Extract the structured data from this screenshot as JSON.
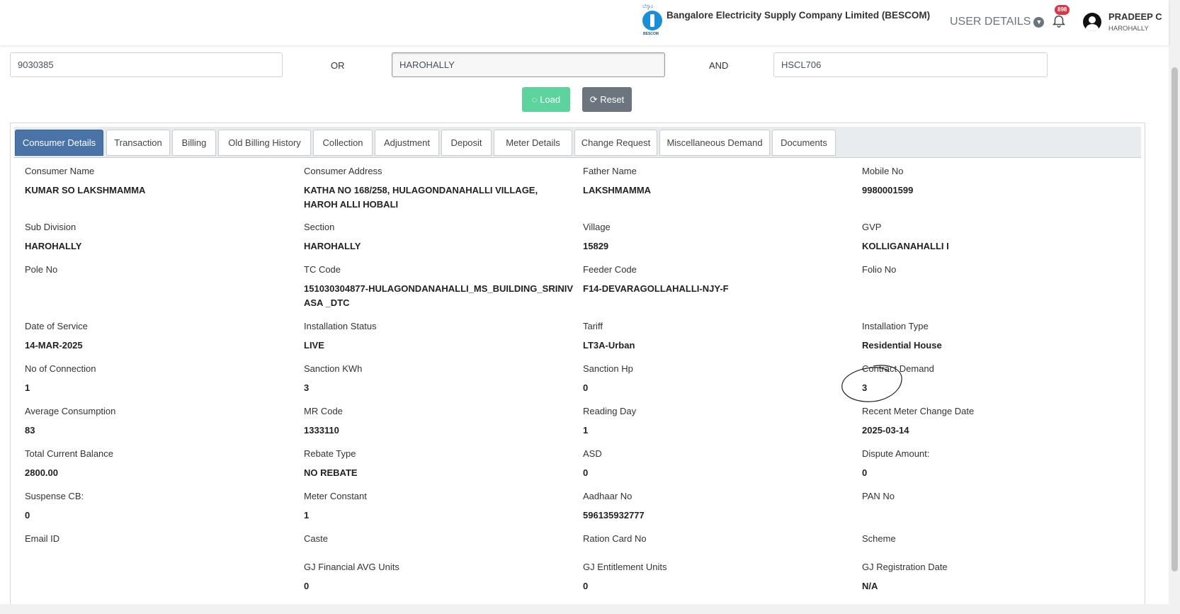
{
  "header": {
    "logo_top": "ಬೆಸ್ಕಾಂ",
    "logo_bottom": "BESCOM",
    "company": "Bangalore Electricity Supply Company Limited (BESCOM)",
    "user_details": "USER DETAILS",
    "notification_count": "898",
    "user_name": "PRADEEP C",
    "user_location": "HAROHALLY"
  },
  "search": {
    "account_value": "9030385",
    "joiner_or": "OR",
    "location_value": "HAROHALLY",
    "joiner_and": "AND",
    "code_value": "HSCL706",
    "load_label": "Load",
    "reset_label": "Reset"
  },
  "tabs": [
    "Consumer Details",
    "Transaction",
    "Billing",
    "Old Billing History",
    "Collection",
    "Adjustment",
    "Deposit",
    "Meter Details",
    "Change Request",
    "Miscellaneous Demand",
    "Documents"
  ],
  "fields": [
    {
      "label": "Consumer Name",
      "value": "KUMAR SO LAKSHMAMMA"
    },
    {
      "label": "Consumer Address",
      "value": "KATHA NO 168/258, HULAGONDANAHALLI VILLAGE, HAROH ALLI HOBALI"
    },
    {
      "label": "Father Name",
      "value": "LAKSHMAMMA"
    },
    {
      "label": "Mobile No",
      "value": "9980001599"
    },
    {
      "label": "Sub Division",
      "value": "HAROHALLY"
    },
    {
      "label": "Section",
      "value": "HAROHALLY"
    },
    {
      "label": "Village",
      "value": "15829"
    },
    {
      "label": "GVP",
      "value": "KOLLIGANAHALLI I"
    },
    {
      "label": "Pole No",
      "value": ""
    },
    {
      "label": "TC Code",
      "value": "151030304877-HULAGONDANAHALLI_MS_BUILDING_SRINIV ASA _DTC"
    },
    {
      "label": "Feeder Code",
      "value": "F14-DEVARAGOLLAHALLI-NJY-F"
    },
    {
      "label": "Folio No",
      "value": ""
    },
    {
      "label": "Date of Service",
      "value": "14-MAR-2025"
    },
    {
      "label": "Installation Status",
      "value": "LIVE"
    },
    {
      "label": "Tariff",
      "value": "LT3A-Urban"
    },
    {
      "label": "Installation Type",
      "value": "Residential House"
    },
    {
      "label": "No of Connection",
      "value": "1"
    },
    {
      "label": "Sanction KWh",
      "value": "3"
    },
    {
      "label": "Sanction Hp",
      "value": "0"
    },
    {
      "label": "Contract Demand",
      "value": "3"
    },
    {
      "label": "Average Consumption",
      "value": "83"
    },
    {
      "label": "MR Code",
      "value": "1333110"
    },
    {
      "label": "Reading Day",
      "value": "1"
    },
    {
      "label": "Recent Meter Change Date",
      "value": "2025-03-14"
    },
    {
      "label": "Total Current Balance",
      "value": "2800.00"
    },
    {
      "label": "Rebate Type",
      "value": "NO REBATE"
    },
    {
      "label": "ASD",
      "value": "0"
    },
    {
      "label": "Dispute Amount:",
      "value": "0"
    },
    {
      "label": "Suspense CB:",
      "value": "0"
    },
    {
      "label": "Meter Constant",
      "value": "1"
    },
    {
      "label": "Aadhaar No",
      "value": "596135932777"
    },
    {
      "label": "PAN No",
      "value": ""
    },
    {
      "label": "Email ID",
      "value": ""
    },
    {
      "label": "Caste",
      "value": ""
    },
    {
      "label": "Ration Card No",
      "value": ""
    },
    {
      "label": "Scheme",
      "value": ""
    },
    {
      "label": "GJ Financial AVG Units",
      "value": "0"
    },
    {
      "label": "GJ Entitlement Units",
      "value": "0"
    },
    {
      "label": "GJ Registration Date",
      "value": "N/A"
    }
  ],
  "colors": {
    "active_tab": "#4a74a8",
    "load_button": "#5dd39e",
    "reset_button": "#6c757d",
    "badge": "#dc3545"
  }
}
